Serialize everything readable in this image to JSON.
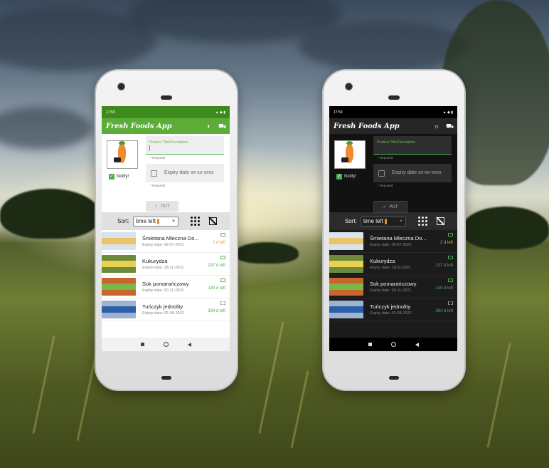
{
  "status_bar": {
    "time": "17:59"
  },
  "app": {
    "title": "Fresh Foods App"
  },
  "form": {
    "title_field_label": "Product Title/Description",
    "required_hint": "* Required",
    "date_placeholder": "Expiry date xx-xx-xxxx",
    "notify_label": "Notify!",
    "notify_checked": true,
    "put_label": "PUT"
  },
  "sort": {
    "label": "Sort:",
    "selected": "time left"
  },
  "items": [
    {
      "title": "Śmietana Mleczna Do...",
      "expiry": "Expiry date: 06-07-2021",
      "left": "2 d left",
      "left_color": "#f0a020",
      "opened": false,
      "thumb_color": "#d9e3ee",
      "thumb_stripe": "#e9c46a"
    },
    {
      "title": "Kukurydza",
      "expiry": "Expiry date: 18-11-2021",
      "left": "137 d left",
      "left_color": "#4caf50",
      "opened": false,
      "thumb_color": "#6d8a3a",
      "thumb_stripe": "#e8d050"
    },
    {
      "title": "Sok pomarańczowy",
      "expiry": "Expiry date: 30-11-2021",
      "left": "149 d left",
      "left_color": "#4caf50",
      "opened": false,
      "thumb_color": "#c9662c",
      "thumb_stripe": "#7ab648"
    },
    {
      "title": "Tuńczyk jednolity",
      "expiry": "Expiry date: 02-08-2022",
      "left": "394 d left",
      "left_color": "#4caf50",
      "opened": true,
      "thumb_color": "#9db3cf",
      "thumb_stripe": "#2b5fa8"
    }
  ],
  "colors": {
    "accent_green": "#5cad38",
    "warning_orange": "#f0a020"
  },
  "icons": {
    "appbar": [
      "theme-toggle-icon",
      "settings-truck-icon"
    ],
    "sort": [
      "grid-view-icon",
      "hide-images-icon"
    ],
    "nav": [
      "recents-icon",
      "home-icon",
      "back-icon"
    ]
  }
}
